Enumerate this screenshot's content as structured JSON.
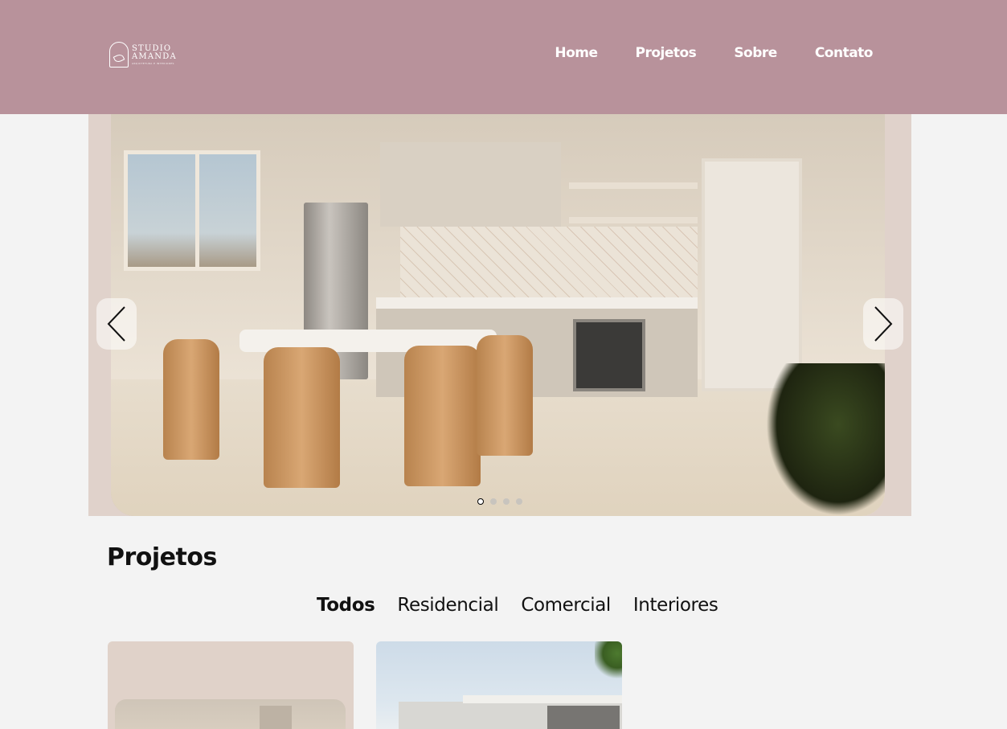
{
  "header": {
    "background": "#b8929b",
    "logo": {
      "line1": "STUDIO",
      "line2": "AMANDA",
      "tagline": "ARQUITETURA E INTERIORES"
    },
    "nav": [
      "Home",
      "Projetos",
      "Sobre",
      "Contato"
    ]
  },
  "carousel": {
    "prev_icon": "chevron-left-icon",
    "next_icon": "chevron-right-icon",
    "slide_count": 4,
    "active_slide": 1
  },
  "projects": {
    "title": "Projetos",
    "filters": [
      "Todos",
      "Residencial",
      "Comercial",
      "Interiores"
    ],
    "active_filter": "Todos"
  }
}
